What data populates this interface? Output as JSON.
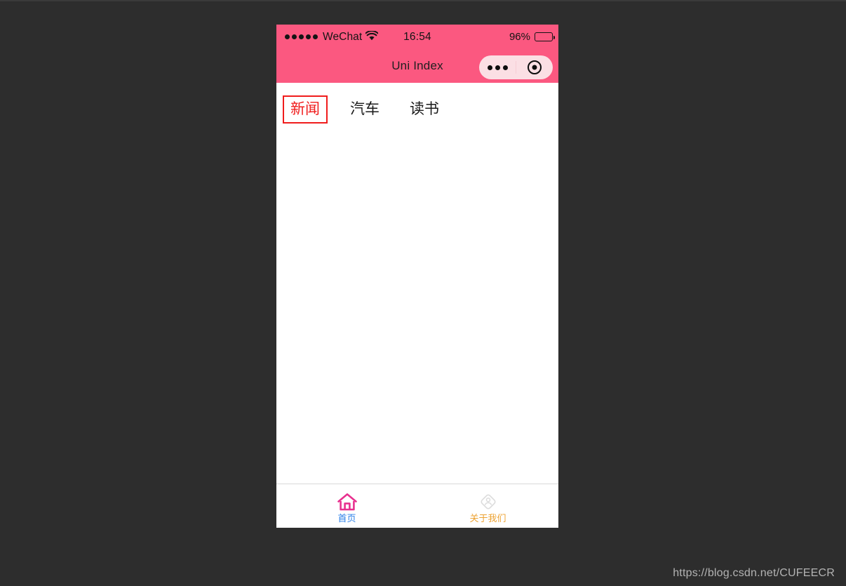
{
  "page": {
    "background_color": "#2d2d2d",
    "watermark": "https://blog.csdn.net/CUFEECR"
  },
  "phone": {
    "status_bar": {
      "carrier": "WeChat",
      "signal_icon": "signal-dots-icon",
      "wifi_icon": "wifi-icon",
      "time": "16:54",
      "battery_percent": "96%",
      "battery_icon": "battery-full-icon",
      "background_color": "#fb5880"
    },
    "nav_bar": {
      "title": "Uni Index",
      "background_color": "#fb5880",
      "capsule": {
        "more_icon": "ellipsis-icon",
        "target_icon": "target-circle-icon"
      }
    },
    "category_tabs": [
      {
        "label": "新闻",
        "active": true,
        "color": "#f01c1c"
      },
      {
        "label": "汽车",
        "active": false,
        "color": "#1a1a1a"
      },
      {
        "label": "读书",
        "active": false,
        "color": "#1a1a1a"
      }
    ],
    "tab_bar": [
      {
        "label": "首页",
        "icon": "home-icon",
        "icon_color": "#e8318f",
        "label_color": "#2a7fe8",
        "active": true
      },
      {
        "label": "关于我们",
        "icon": "user-diamond-icon",
        "icon_color": "#d4d4d4",
        "label_color": "#eda232",
        "active": false
      }
    ]
  }
}
